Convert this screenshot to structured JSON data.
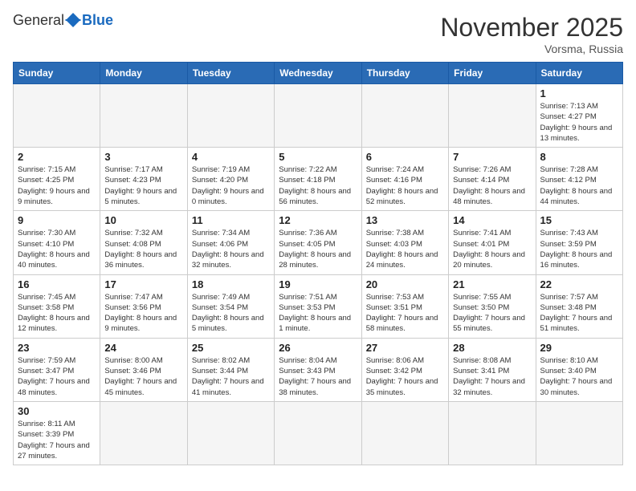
{
  "header": {
    "logo_general": "General",
    "logo_blue": "Blue",
    "month_title": "November 2025",
    "location": "Vorsma, Russia"
  },
  "weekdays": [
    "Sunday",
    "Monday",
    "Tuesday",
    "Wednesday",
    "Thursday",
    "Friday",
    "Saturday"
  ],
  "weeks": [
    [
      {
        "day": null
      },
      {
        "day": null
      },
      {
        "day": null
      },
      {
        "day": null
      },
      {
        "day": null
      },
      {
        "day": null
      },
      {
        "day": "1",
        "sunrise": "7:13 AM",
        "sunset": "4:27 PM",
        "daylight": "9 hours and 13 minutes."
      }
    ],
    [
      {
        "day": "2",
        "sunrise": "7:15 AM",
        "sunset": "4:25 PM",
        "daylight": "9 hours and 9 minutes."
      },
      {
        "day": "3",
        "sunrise": "7:17 AM",
        "sunset": "4:23 PM",
        "daylight": "9 hours and 5 minutes."
      },
      {
        "day": "4",
        "sunrise": "7:19 AM",
        "sunset": "4:20 PM",
        "daylight": "9 hours and 0 minutes."
      },
      {
        "day": "5",
        "sunrise": "7:22 AM",
        "sunset": "4:18 PM",
        "daylight": "8 hours and 56 minutes."
      },
      {
        "day": "6",
        "sunrise": "7:24 AM",
        "sunset": "4:16 PM",
        "daylight": "8 hours and 52 minutes."
      },
      {
        "day": "7",
        "sunrise": "7:26 AM",
        "sunset": "4:14 PM",
        "daylight": "8 hours and 48 minutes."
      },
      {
        "day": "8",
        "sunrise": "7:28 AM",
        "sunset": "4:12 PM",
        "daylight": "8 hours and 44 minutes."
      }
    ],
    [
      {
        "day": "9",
        "sunrise": "7:30 AM",
        "sunset": "4:10 PM",
        "daylight": "8 hours and 40 minutes."
      },
      {
        "day": "10",
        "sunrise": "7:32 AM",
        "sunset": "4:08 PM",
        "daylight": "8 hours and 36 minutes."
      },
      {
        "day": "11",
        "sunrise": "7:34 AM",
        "sunset": "4:06 PM",
        "daylight": "8 hours and 32 minutes."
      },
      {
        "day": "12",
        "sunrise": "7:36 AM",
        "sunset": "4:05 PM",
        "daylight": "8 hours and 28 minutes."
      },
      {
        "day": "13",
        "sunrise": "7:38 AM",
        "sunset": "4:03 PM",
        "daylight": "8 hours and 24 minutes."
      },
      {
        "day": "14",
        "sunrise": "7:41 AM",
        "sunset": "4:01 PM",
        "daylight": "8 hours and 20 minutes."
      },
      {
        "day": "15",
        "sunrise": "7:43 AM",
        "sunset": "3:59 PM",
        "daylight": "8 hours and 16 minutes."
      }
    ],
    [
      {
        "day": "16",
        "sunrise": "7:45 AM",
        "sunset": "3:58 PM",
        "daylight": "8 hours and 12 minutes."
      },
      {
        "day": "17",
        "sunrise": "7:47 AM",
        "sunset": "3:56 PM",
        "daylight": "8 hours and 9 minutes."
      },
      {
        "day": "18",
        "sunrise": "7:49 AM",
        "sunset": "3:54 PM",
        "daylight": "8 hours and 5 minutes."
      },
      {
        "day": "19",
        "sunrise": "7:51 AM",
        "sunset": "3:53 PM",
        "daylight": "8 hours and 1 minute."
      },
      {
        "day": "20",
        "sunrise": "7:53 AM",
        "sunset": "3:51 PM",
        "daylight": "7 hours and 58 minutes."
      },
      {
        "day": "21",
        "sunrise": "7:55 AM",
        "sunset": "3:50 PM",
        "daylight": "7 hours and 55 minutes."
      },
      {
        "day": "22",
        "sunrise": "7:57 AM",
        "sunset": "3:48 PM",
        "daylight": "7 hours and 51 minutes."
      }
    ],
    [
      {
        "day": "23",
        "sunrise": "7:59 AM",
        "sunset": "3:47 PM",
        "daylight": "7 hours and 48 minutes."
      },
      {
        "day": "24",
        "sunrise": "8:00 AM",
        "sunset": "3:46 PM",
        "daylight": "7 hours and 45 minutes."
      },
      {
        "day": "25",
        "sunrise": "8:02 AM",
        "sunset": "3:44 PM",
        "daylight": "7 hours and 41 minutes."
      },
      {
        "day": "26",
        "sunrise": "8:04 AM",
        "sunset": "3:43 PM",
        "daylight": "7 hours and 38 minutes."
      },
      {
        "day": "27",
        "sunrise": "8:06 AM",
        "sunset": "3:42 PM",
        "daylight": "7 hours and 35 minutes."
      },
      {
        "day": "28",
        "sunrise": "8:08 AM",
        "sunset": "3:41 PM",
        "daylight": "7 hours and 32 minutes."
      },
      {
        "day": "29",
        "sunrise": "8:10 AM",
        "sunset": "3:40 PM",
        "daylight": "7 hours and 30 minutes."
      }
    ],
    [
      {
        "day": "30",
        "sunrise": "8:11 AM",
        "sunset": "3:39 PM",
        "daylight": "7 hours and 27 minutes."
      },
      {
        "day": null
      },
      {
        "day": null
      },
      {
        "day": null
      },
      {
        "day": null
      },
      {
        "day": null
      },
      {
        "day": null
      }
    ]
  ]
}
